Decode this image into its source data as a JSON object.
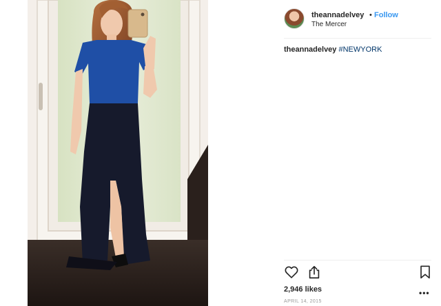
{
  "post": {
    "username": "theannadelvey",
    "separator": "•",
    "follow_label": "Follow",
    "location": "The Mercer",
    "caption": {
      "username": "theannadelvey",
      "hashtag": "#NEWYORK"
    },
    "likes": "2,946 likes",
    "date": "APRIL 14, 2015",
    "more_label": "•••"
  },
  "icons": {
    "like": "heart-icon",
    "share": "share-icon",
    "save": "bookmark-icon",
    "more": "more-options-icon"
  },
  "colors": {
    "link_blue": "#3897f0",
    "hashtag": "#003569",
    "text": "#262626",
    "muted": "#999999"
  }
}
